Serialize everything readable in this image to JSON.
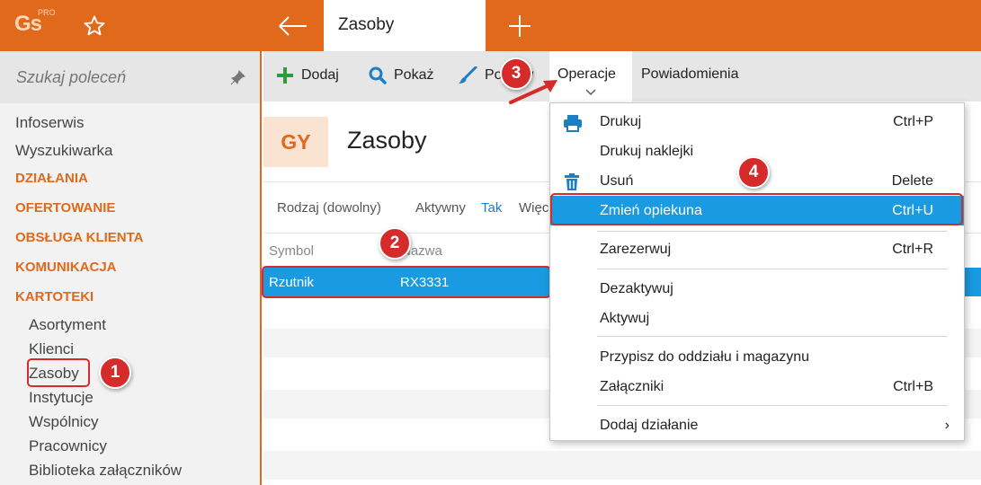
{
  "app": {
    "logo_text": "Gs",
    "logo_badge": "PRO",
    "tab_title": "Zasoby"
  },
  "sidebar": {
    "search_placeholder": "Szukaj poleceń",
    "items": [
      "Infoserwis",
      "Wyszukiwarka"
    ],
    "categories": [
      "DZIAŁANIA",
      "OFERTOWANIE",
      "OBSŁUGA KLIENTA",
      "KOMUNIKACJA",
      "KARTOTEKI"
    ],
    "kartoteki_items": [
      "Asortyment",
      "Klienci",
      "Zasoby",
      "Instytucje",
      "Wspólnicy",
      "Pracownicy",
      "Biblioteka załączników"
    ]
  },
  "toolbar": {
    "add_label": "Dodaj",
    "show_label": "Pokaż",
    "edit_label": "Popraw",
    "operations_label": "Operacje",
    "notifications_label": "Powiadomienia"
  },
  "main": {
    "badge": "GY",
    "title": "Zasoby",
    "filters": {
      "kind": "Rodzaj (dowolny)",
      "active_label": "Aktywny",
      "active_value": "Tak",
      "more": "Więcej"
    },
    "columns": [
      "Symbol",
      "Nazwa"
    ],
    "rows": [
      {
        "symbol": "Rzutnik",
        "name": "RX3331"
      }
    ]
  },
  "menu": {
    "items": [
      {
        "label": "Drukuj",
        "shortcut": "Ctrl+P",
        "icon": "printer-icon"
      },
      {
        "label": "Drukuj naklejki",
        "shortcut": ""
      },
      {
        "label": "Usuń",
        "shortcut": "Delete",
        "icon": "trash-icon"
      },
      {
        "label": "Zmień opiekuna",
        "shortcut": "Ctrl+U"
      },
      {
        "label": "Zarezerwuj",
        "shortcut": "Ctrl+R"
      },
      {
        "label": "Dezaktywuj",
        "shortcut": ""
      },
      {
        "label": "Aktywuj",
        "shortcut": ""
      },
      {
        "label": "Przypisz do oddziału i magazynu",
        "shortcut": ""
      },
      {
        "label": "Załączniki",
        "shortcut": "Ctrl+B"
      },
      {
        "label": "Dodaj działanie",
        "shortcut": "›"
      }
    ]
  },
  "callouts": [
    "1",
    "2",
    "3",
    "4"
  ],
  "colors": {
    "accent": "#e0691b",
    "selection": "#1a9ae0",
    "highlight": "#d52b2b",
    "add_icon": "#2e9b3c"
  }
}
